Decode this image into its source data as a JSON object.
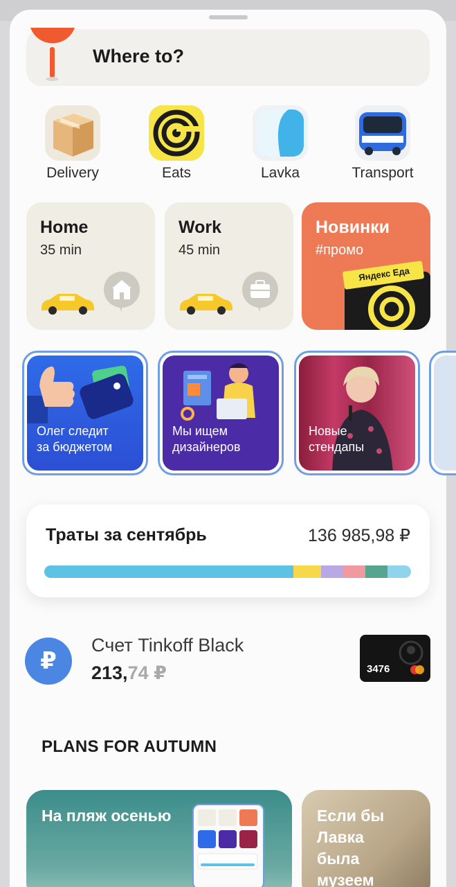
{
  "search": {
    "label": "Where to?"
  },
  "services": [
    {
      "label": "Delivery",
      "icon": "box-icon"
    },
    {
      "label": "Eats",
      "icon": "spiral-icon"
    },
    {
      "label": "Lavka",
      "icon": "lavka-icon"
    },
    {
      "label": "Transport",
      "icon": "bus-icon"
    }
  ],
  "destinations": [
    {
      "title": "Home",
      "time": "35 min"
    },
    {
      "title": "Work",
      "time": "45 min"
    },
    {
      "title": "Новинки",
      "subtitle": "#промо",
      "badge": "Яндекс Еда"
    }
  ],
  "stories": [
    {
      "caption": "Олег следит\nза бюджетом"
    },
    {
      "caption": "Мы ищем\nдизайнеров"
    },
    {
      "caption": "Новые\nстендапы"
    }
  ],
  "spending": {
    "title": "Траты за сентябрь",
    "amount": "136 985,98 ₽",
    "segments": [
      {
        "color": "#5ec2e4",
        "share": 0.68
      },
      {
        "color": "#f6d84a",
        "share": 0.075
      },
      {
        "color": "#b8a9e6",
        "share": 0.06
      },
      {
        "color": "#f09aa0",
        "share": 0.06
      },
      {
        "color": "#57a58f",
        "share": 0.06
      },
      {
        "color": "#8fd4ec",
        "share": 0.065
      }
    ]
  },
  "account": {
    "icon_glyph": "₽",
    "name": "Счет Tinkoff Black",
    "balance_main": "213,",
    "balance_fraction": "74 ₽",
    "card_number": "3476"
  },
  "section_title": "PLANS FOR AUTUMN",
  "plans": [
    {
      "title": "На пляж осенью"
    },
    {
      "title": "Если бы\nЛавка\nбыла\nмузеем"
    }
  ],
  "colors": {
    "accent_blue": "#4a86e2",
    "promo_orange": "#ee7a55",
    "card_beige": "#f0ede4"
  }
}
